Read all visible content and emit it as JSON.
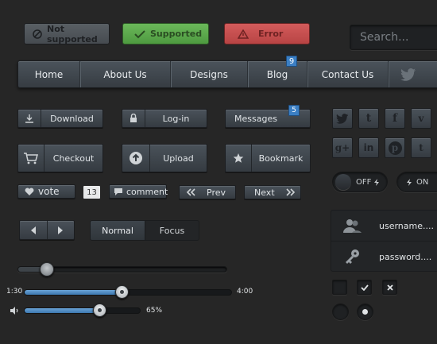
{
  "alerts": {
    "not_supported": "Not supported",
    "supported": "Supported",
    "error": "Error"
  },
  "search": {
    "placeholder": "Search..."
  },
  "nav": {
    "items": [
      {
        "label": "Home"
      },
      {
        "label": "About Us"
      },
      {
        "label": "Designs"
      },
      {
        "label": "Blog",
        "badge": "9"
      },
      {
        "label": "Contact Us"
      }
    ]
  },
  "buttons": {
    "download": "Download",
    "login": "Log-in",
    "messages": "Messages",
    "messages_badge": "5",
    "checkout": "Checkout",
    "upload": "Upload",
    "bookmark": "Bookmark",
    "vote": "vote",
    "vote_count": "13",
    "comment": "comment",
    "prev": "Prev",
    "next": "Next"
  },
  "segmented": {
    "normal": "Normal",
    "focus": "Focus"
  },
  "social": [
    "twitter",
    "tumblr",
    "facebook",
    "vimeo",
    "google-plus",
    "linkedin",
    "pinterest",
    "tumblr-alt"
  ],
  "toggles": {
    "off_label": "OFF",
    "on_label": "ON"
  },
  "login": {
    "username": "username....",
    "password": "password...."
  },
  "slider": {
    "value": 0.14
  },
  "player": {
    "current": "1:30",
    "duration": "4:00",
    "progress": 0.47
  },
  "volume": {
    "percent_label": "65%",
    "value": 0.65
  },
  "colors": {
    "accent": "#3b7fc4",
    "success": "#5aa64a",
    "error": "#c94a4a",
    "background": "#262626"
  }
}
